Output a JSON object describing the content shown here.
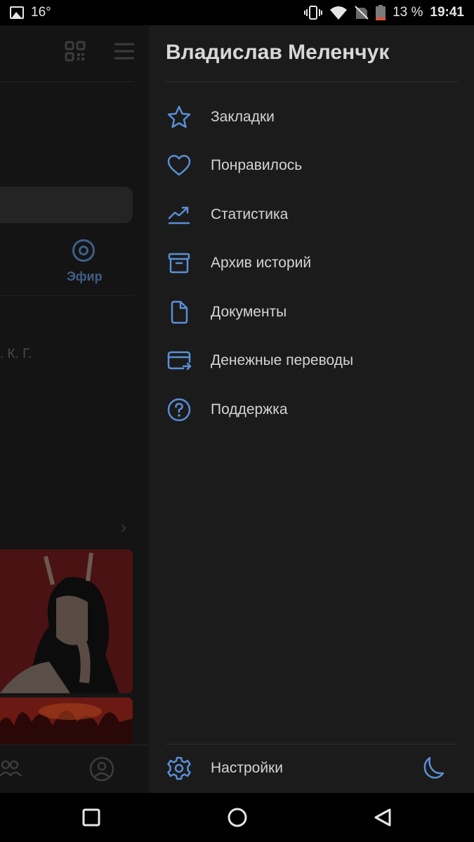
{
  "status_bar": {
    "temperature": "16°",
    "battery": "13 %",
    "time": "19:41"
  },
  "background_app": {
    "efir_label": "Эфир",
    "truncated_text": ". К. Г."
  },
  "drawer": {
    "user_name": "Владислав Меленчук",
    "menu_items": [
      {
        "label": "Закладки",
        "icon": "star-icon"
      },
      {
        "label": "Понравилось",
        "icon": "heart-icon"
      },
      {
        "label": "Статистика",
        "icon": "chart-trend-icon"
      },
      {
        "label": "Архив историй",
        "icon": "archive-icon"
      },
      {
        "label": "Документы",
        "icon": "document-icon"
      },
      {
        "label": "Денежные переводы",
        "icon": "money-transfer-icon"
      },
      {
        "label": "Поддержка",
        "icon": "help-icon"
      }
    ],
    "settings_label": "Настройки"
  },
  "colors": {
    "accent": "#5a8fd6",
    "drawer_bg": "#1b1b1b",
    "text": "#d4d4d4"
  }
}
